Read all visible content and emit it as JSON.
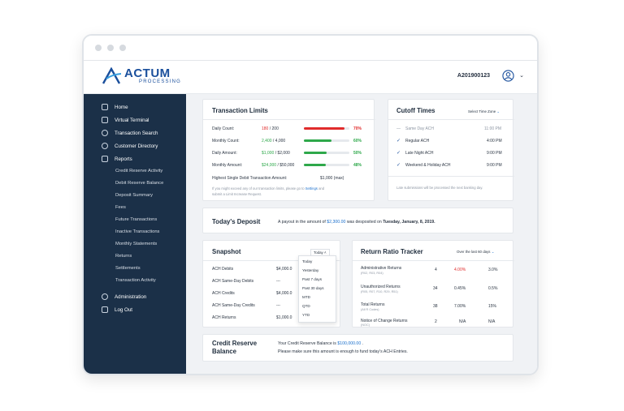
{
  "header": {
    "logo_main": "ACTUM",
    "logo_sub": "PROCESSING",
    "account_id": "A201900123"
  },
  "sidebar": {
    "items": [
      {
        "label": "Home"
      },
      {
        "label": "Virtual Terminal"
      },
      {
        "label": "Transaction Search"
      },
      {
        "label": "Customer Directory"
      },
      {
        "label": "Reports"
      }
    ],
    "report_subitems": [
      "Credit Reserve Activity",
      "Debit Reserve Balance",
      "Deposit Summary",
      "Fees",
      "Future Transactions",
      "Inactive Transactions",
      "Monthly Statements",
      "Returns",
      "Settlements",
      "Transaction Activity"
    ],
    "bottom_items": [
      {
        "label": "Administration"
      },
      {
        "label": "Log Out"
      }
    ]
  },
  "transaction_limits": {
    "title": "Transaction Limits",
    "rows": [
      {
        "label": "Daily Count:",
        "used": "180",
        "limit": "/ 200",
        "percent": "70%",
        "fill": 0.9,
        "color": "#e02b2b"
      },
      {
        "label": "Monthly Count:",
        "used": "2,400",
        "limit": "/ 4,000",
        "percent": "60%",
        "fill": 0.6,
        "color": "#2ea84a"
      },
      {
        "label": "Daily Amount:",
        "used": "$1,000",
        "limit": "/ $2,000",
        "percent": "50%",
        "fill": 0.5,
        "color": "#2ea84a"
      },
      {
        "label": "Monthly Amount:",
        "used": "$24,000",
        "limit": "/ $50,000",
        "percent": "48%",
        "fill": 0.48,
        "color": "#2ea84a"
      }
    ],
    "single_debit_label": "Highest Single Debit Transaction Amount:",
    "single_debit_value": "$1,000 (max)",
    "note_line1_pre": "If you might exceed any of our transaction limits, please go to",
    "note_link": "Settings",
    "note_line1_post": "and",
    "note_line2": "submit a Limit Increase Request."
  },
  "cutoff_times": {
    "title": "Cutoff Times",
    "timezone_label": "Select Time Zone",
    "rows": [
      {
        "label": "Same Day ACH",
        "time": "11:00 PM",
        "active": false
      },
      {
        "label": "Regular ACH",
        "time": "4:00 PM",
        "active": true
      },
      {
        "label": "Late Night ACH",
        "time": "9:00 PM",
        "active": true
      },
      {
        "label": "Weekend & Holiday ACH",
        "time": "9:00 PM",
        "active": true
      }
    ],
    "footer": "Late submissions will be processed the next banking day."
  },
  "deposit": {
    "title": "Today's Deposit",
    "text_pre": "A payout in the amount of",
    "amount": "$2,300.00",
    "text_mid": "was desposited on",
    "date": "Tuesday, January, 8, 2019."
  },
  "snapshot": {
    "title": "Snapshot",
    "range": "Today",
    "rows": [
      {
        "label": "ACH Debits",
        "value": "$4,000.0"
      },
      {
        "label": "ACH Same-Day Debits",
        "value": "---"
      },
      {
        "label": "ACH Credits",
        "value": "$4,000.0"
      },
      {
        "label": "ACH Same-Day Credits",
        "value": "---"
      },
      {
        "label": "ACH Returns",
        "value": "$1,000.0"
      }
    ],
    "dropdown_options": [
      "Today",
      "Yesterday",
      "Past 7 days",
      "Past 30 days",
      "MTD",
      "QTD",
      "YTD"
    ]
  },
  "return_ratio": {
    "title": "Return Ratio Tracker",
    "range": "Over the last 60 days",
    "rows": [
      {
        "label": "Administrative Returns",
        "codes": "(R02, R03, R04)",
        "count": "4",
        "pct": "4.00%",
        "limit": "3.0%",
        "alert": true
      },
      {
        "label": "Unauthorized Returns",
        "codes": "(R05, R07, R10, R29, R51)",
        "count": "34",
        "pct": "0.45%",
        "limit": "0.5%",
        "alert": false
      },
      {
        "label": "Total Returns",
        "codes": "(All R Codes)",
        "count": "38",
        "pct": "7.00%",
        "limit": "15%",
        "alert": false
      },
      {
        "label": "Notice of Change Returns",
        "codes": "(NOC)",
        "count": "2",
        "pct": "N/A",
        "limit": "N/A",
        "alert": false
      }
    ]
  },
  "credit_reserve": {
    "title_line1": "Credit Reserve",
    "title_line2": "Balance",
    "text_pre": "Your Credit Reserve Balance is",
    "amount": "$100,000.00",
    "text_post": ".",
    "line2": "Please make sure this amount is enough to fund today's ACH Entries."
  }
}
